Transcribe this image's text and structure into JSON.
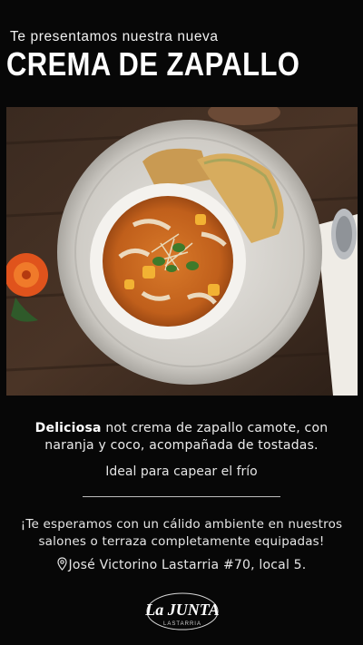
{
  "header": {
    "intro": "Te presentamos nuestra nueva",
    "title": "CREMA DE ZAPALLO"
  },
  "photo": {
    "alt": "Crema de zapallo con tostadas"
  },
  "description": {
    "highlight": "Deliciosa",
    "line1_rest": " not crema de zapallo camote, con",
    "line2": "naranja y coco, acompañada de tostadas.",
    "tagline": "Ideal para capear el frío"
  },
  "invite": {
    "line1": "¡Te esperamos con un cálido ambiente en nuestros",
    "line2": "salones o terraza completamente equipadas!"
  },
  "address": {
    "text": "José Victorino Lastarria #70, local 5.",
    "icon": "location-pin-icon"
  },
  "brand": {
    "logo_text": "La JUNTA",
    "logo_sub": "LASTARRIA"
  },
  "colors": {
    "background": "#070707",
    "soup": "#c8641c",
    "text": "#e9e9e9"
  }
}
